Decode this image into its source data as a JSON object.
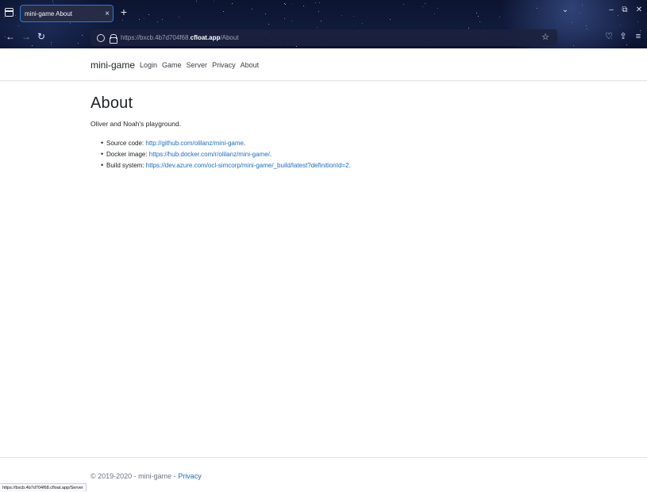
{
  "browser": {
    "tab_title": "mini-game About",
    "tab_close": "×",
    "new_tab": "+",
    "url_prefix": "https://bxcb.4b7d704f68.",
    "url_host": "cfloat.app",
    "url_path": "/About",
    "status_url": "https://bxcb.4b7d704f68.cfloat.app/Server",
    "icons": {
      "tab_list": "tab-list-icon",
      "back": "back-arrow-icon",
      "forward": "forward-arrow-icon",
      "reload": "reload-icon",
      "tracking": "shield-icon",
      "security": "lock-icon",
      "bookmark": "star-icon",
      "pocket": "pocket-icon",
      "extensions": "extensions-icon",
      "menu": "hamburger-menu-icon"
    }
  },
  "site": {
    "brand": "mini-game",
    "nav": [
      "Login",
      "Game",
      "Server",
      "Privacy",
      "About"
    ]
  },
  "page": {
    "title": "About",
    "lead": "Oliver and Noah's playground.",
    "items": [
      {
        "label": "Source code: ",
        "link": "http://github.com/olilanz/mini-game",
        "suffix": "."
      },
      {
        "label": "Docker image: ",
        "link": "https://hub.docker.com/r/olilanz/mini-game/",
        "suffix": "."
      },
      {
        "label": "Build system: ",
        "link": "https://dev.azure.com/ocl-simcorp/mini-game/_build/latest?definitionId=2",
        "suffix": "."
      }
    ]
  },
  "footer": {
    "copyright": "© 2019-2020 - mini-game - ",
    "privacy_link": "Privacy"
  },
  "colors": {
    "link": "#1b6ec2",
    "tab_border": "#2b7ad6",
    "chrome_bg": "#0c1430"
  }
}
